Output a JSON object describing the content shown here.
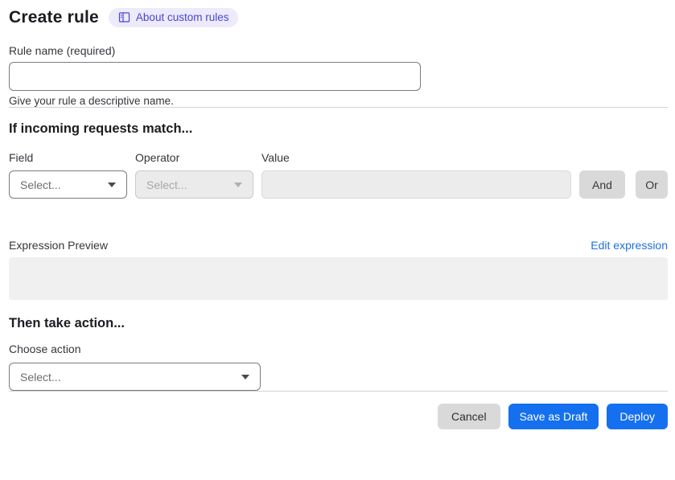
{
  "page": {
    "title": "Create rule"
  },
  "about_link": {
    "label": "About custom rules"
  },
  "rule_name": {
    "label": "Rule name (required)",
    "value": "",
    "helper": "Give your rule a descriptive name."
  },
  "match": {
    "heading": "If incoming requests match...",
    "field_label": "Field",
    "field_placeholder": "Select...",
    "operator_label": "Operator",
    "operator_placeholder": "Select...",
    "value_label": "Value",
    "value_text": "",
    "and_button": "And",
    "or_button": "Or",
    "preview_label": "Expression Preview",
    "edit_link": "Edit expression",
    "preview_content": ""
  },
  "action": {
    "heading": "Then take action...",
    "label": "Choose action",
    "placeholder": "Select..."
  },
  "footer": {
    "cancel": "Cancel",
    "save_draft": "Save as Draft",
    "deploy": "Deploy"
  },
  "colors": {
    "primary_blue": "#1570EF",
    "link_blue": "#1D70D8",
    "badge_bg": "#ECEAFB",
    "badge_text": "#4946D6"
  }
}
